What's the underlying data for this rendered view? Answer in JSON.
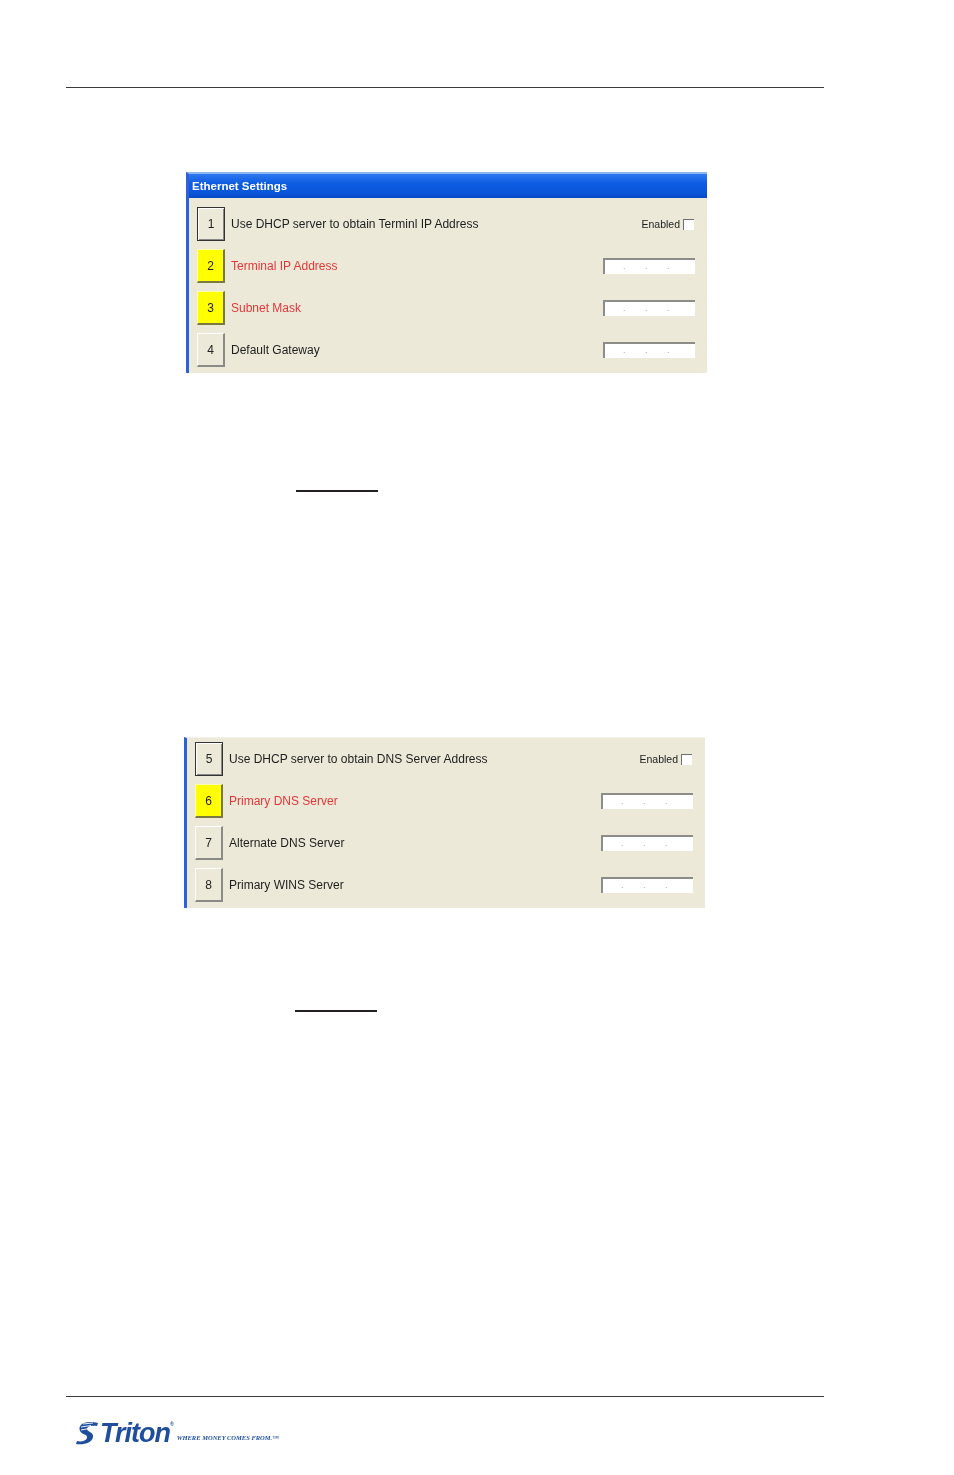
{
  "panels": [
    {
      "title": "Ethernet Settings",
      "rows": [
        {
          "kind": "checkbox",
          "number": "1",
          "label": "Use DHCP server to obtain Terminl IP Address",
          "highlighted": false,
          "checkbox_label": "Enabled",
          "checked": false
        },
        {
          "kind": "ip",
          "number": "2",
          "label": "Terminal IP Address",
          "highlighted": true,
          "value": ". . ."
        },
        {
          "kind": "ip",
          "number": "3",
          "label": "Subnet Mask",
          "highlighted": true,
          "value": ". . ."
        },
        {
          "kind": "ip",
          "number": "4",
          "label": "Default Gateway",
          "highlighted": false,
          "value": ". . ."
        }
      ]
    },
    {
      "rows": [
        {
          "kind": "checkbox",
          "number": "5",
          "label": "Use DHCP server to obtain DNS Server Address",
          "highlighted": false,
          "checkbox_label": "Enabled",
          "checked": false
        },
        {
          "kind": "ip",
          "number": "6",
          "label": "Primary DNS Server",
          "highlighted": true,
          "value": ". . ."
        },
        {
          "kind": "ip",
          "number": "7",
          "label": "Alternate DNS Server",
          "highlighted": false,
          "value": ". . ."
        },
        {
          "kind": "ip",
          "number": "8",
          "label": "Primary WINS Server",
          "highlighted": false,
          "value": ". . ."
        }
      ]
    }
  ],
  "footer": {
    "brand": "Triton$^{®}$",
    "tagline": "WHERE MONEY COMES FROM.™"
  }
}
